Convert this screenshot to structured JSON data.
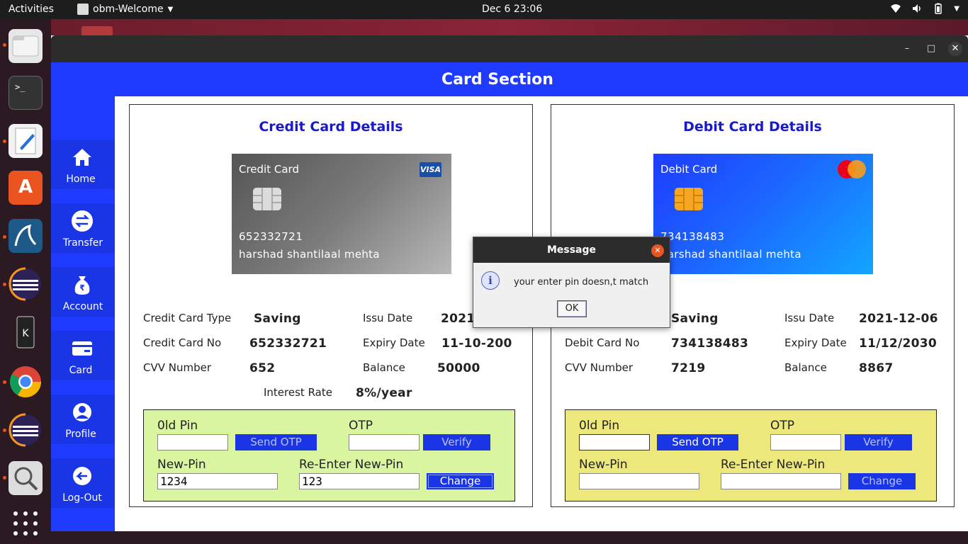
{
  "topbar": {
    "activities": "Activities",
    "app_menu": "obm-Welcome",
    "clock": "Dec 6  23:06"
  },
  "dock": {
    "items": [
      "files-icon",
      "terminal-icon",
      "text-editor-icon",
      "software-icon",
      "mysql-workbench-icon",
      "eclipse-icon",
      "kde-connect-icon",
      "chrome-icon",
      "eclipse-icon-2",
      "image-viewer-icon",
      "app-grid-icon"
    ]
  },
  "window": {
    "header_title": "Card Section",
    "controls": {
      "minimize": "–",
      "maximize": "□",
      "close": "✕"
    }
  },
  "sidebar": {
    "items": [
      {
        "label": "Home",
        "icon": "home-icon"
      },
      {
        "label": "Transfer",
        "icon": "transfer-icon"
      },
      {
        "label": "Account",
        "icon": "rupee-bag-icon"
      },
      {
        "label": "Card",
        "icon": "card-icon"
      },
      {
        "label": "Profile",
        "icon": "profile-icon"
      },
      {
        "label": "Log-Out",
        "icon": "logout-icon"
      }
    ]
  },
  "credit": {
    "title": "Credit Card Details",
    "card": {
      "type_label": "Credit Card",
      "brand": "VISA",
      "number": "652332721",
      "holder": "harshad shantilaal mehta"
    },
    "labels": {
      "type": "Credit Card Type",
      "number": "Credit Card No",
      "cvv": "CVV Number",
      "issue": "Issu Date",
      "expiry": "Expiry Date",
      "balance": "Balance",
      "interest": "Interest Rate"
    },
    "values": {
      "type": "Saving",
      "number": "652332721",
      "cvv": "652",
      "issue": "2021",
      "expiry": "11-10-200",
      "balance": "50000",
      "interest": "8%/year"
    },
    "pin": {
      "old_label": "0ld Pin",
      "otp_label": "OTP",
      "new_label": "New-Pin",
      "reenter_label": "Re-Enter New-Pin",
      "old_value": "",
      "otp_value": "",
      "new_value": "1234",
      "reenter_value": "123",
      "send_otp": "Send OTP",
      "verify": "Verify",
      "change": "Change"
    }
  },
  "debit": {
    "title": "Debit Card Details",
    "card": {
      "type_label": "Debit Card",
      "number": "734138483",
      "holder": "harshad shantilaal mehta"
    },
    "labels": {
      "number": "Debit Card No",
      "cvv": "CVV Number",
      "issue": "Issu Date",
      "expiry": "Expiry Date",
      "balance": "Balance"
    },
    "values": {
      "type": "Saving",
      "number": "734138483",
      "cvv": "7219",
      "issue": "2021-12-06",
      "expiry": "11/12/2030",
      "balance": "8867"
    },
    "pin": {
      "old_label": "0ld Pin",
      "otp_label": "OTP",
      "new_label": "New-Pin",
      "reenter_label": "Re-Enter New-Pin",
      "old_value": "",
      "otp_value": "",
      "new_value": "",
      "reenter_value": "",
      "send_otp": "Send OTP",
      "verify": "Verify",
      "change": "Change"
    }
  },
  "dialog": {
    "title": "Message",
    "message": "your enter pin doesn,t match",
    "ok": "OK",
    "icon": "info-icon"
  },
  "colors": {
    "header_blue": "#1f3bff",
    "title_blue": "#1a1acc",
    "credit_pin_bg": "#d9f5a0",
    "debit_pin_bg": "#ece87c",
    "button_blue": "#1a35e6"
  }
}
